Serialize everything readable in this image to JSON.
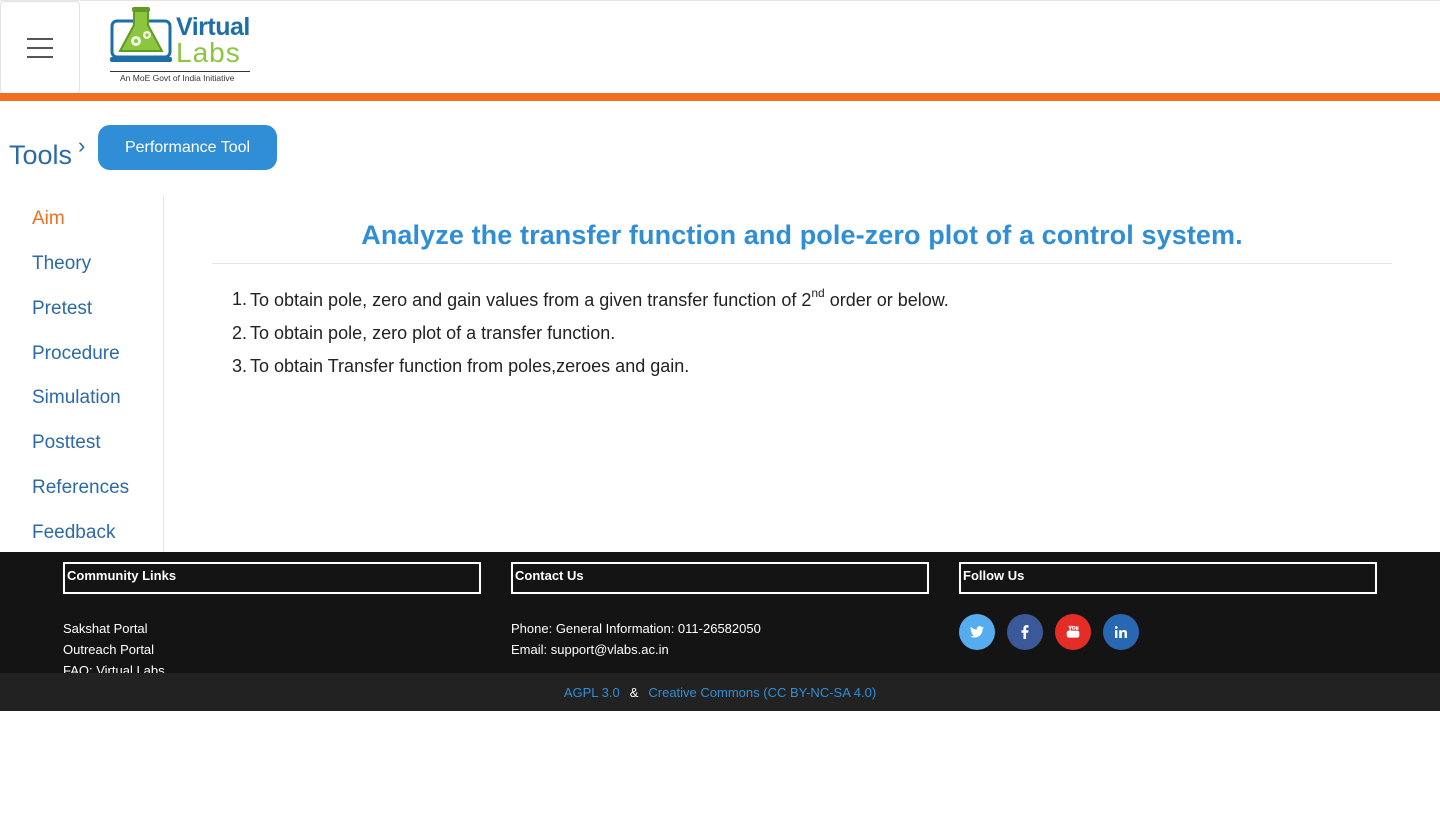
{
  "header": {
    "logo_word_1": "Virtual",
    "logo_word_2": "Labs",
    "logo_tagline": "An MoE Govt of India Initiative"
  },
  "breadcrumb": {
    "tools": "Tools",
    "separator": "›",
    "current": "Performance Tool"
  },
  "sidebar": {
    "items": [
      {
        "label": "Aim",
        "active": true
      },
      {
        "label": "Theory",
        "active": false
      },
      {
        "label": "Pretest",
        "active": false
      },
      {
        "label": "Procedure",
        "active": false
      },
      {
        "label": "Simulation",
        "active": false
      },
      {
        "label": "Posttest",
        "active": false
      },
      {
        "label": "References",
        "active": false
      },
      {
        "label": "Feedback",
        "active": false
      }
    ]
  },
  "main": {
    "title": "Analyze the transfer function and pole-zero plot of a control system.",
    "aims": [
      {
        "num": "1.",
        "text_before": "To obtain pole, zero and gain values from a given transfer function of 2",
        "sup": "nd",
        "text_after": " order or below."
      },
      {
        "num": "2.",
        "text_before": "To obtain pole, zero plot of a transfer function.",
        "sup": "",
        "text_after": ""
      },
      {
        "num": "3.",
        "text_before": "To obtain Transfer function from poles,zeroes and gain.",
        "sup": "",
        "text_after": ""
      }
    ]
  },
  "footer": {
    "community": {
      "heading": "Community Links",
      "links": [
        "Sakshat Portal",
        "Outreach Portal",
        "FAQ: Virtual Labs"
      ]
    },
    "contact": {
      "heading": "Contact Us",
      "phone": "Phone: General Information: 011-26582050",
      "email": "Email: support@vlabs.ac.in"
    },
    "follow": {
      "heading": "Follow Us",
      "icons": [
        "twitter-icon",
        "facebook-icon",
        "youtube-icon",
        "linkedin-icon"
      ]
    },
    "license": {
      "agpl": "AGPL 3.0",
      "amp": "&",
      "cc": "Creative Commons (CC BY-NC-SA 4.0)"
    }
  },
  "colors": {
    "accent_orange": "#f26f21",
    "link_blue": "#2c6aa6",
    "button_blue": "#2f8ed6",
    "footer_bg": "#141414"
  }
}
